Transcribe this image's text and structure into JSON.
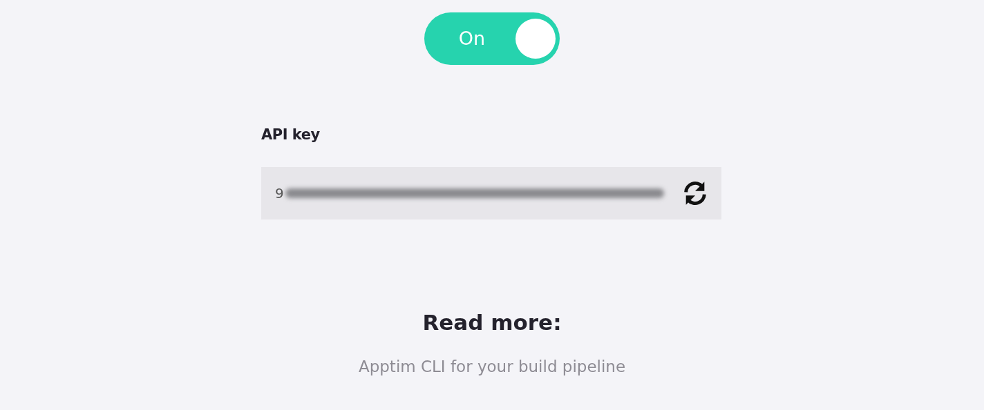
{
  "toggle": {
    "label": "On",
    "on": true
  },
  "api_key": {
    "label": "API key",
    "value": "9"
  },
  "read_more": {
    "title": "Read more:",
    "link": "Apptim CLI for your build pipeline"
  }
}
